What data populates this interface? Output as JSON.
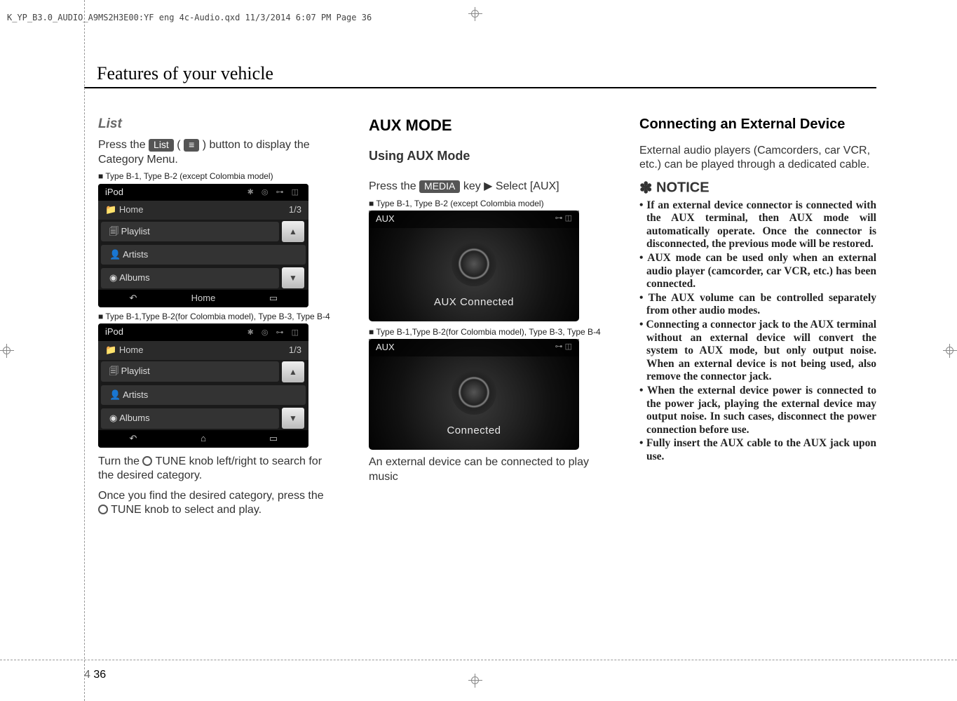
{
  "header_line": "K_YP_B3.0_AUDIO_A9MS2H3E00:YF eng 4c-Audio.qxd  11/3/2014  6:07 PM  Page 36",
  "page_title": "Features of your vehicle",
  "col1": {
    "list_heading": "List",
    "press_the": "Press the ",
    "list_keycap": "List",
    "button_to": " button to display the Category Menu.",
    "cap1": "■ Type B-1, Type B-2 (except Colombia model)",
    "cap2": "■ Type B-1,Type B-2(for Colombia model), Type B-3, Type B-4",
    "ipod": "iPod",
    "home": "Home",
    "count": "1/3",
    "playlist": "Playlist",
    "artists": "Artists",
    "albums": "Albums",
    "home_btn": "Home",
    "turn": "Turn the ",
    "tune1": "TUNE knob left/right to search for the desired category.",
    "once": "Once you find the desired category, press the ",
    "tune2": "TUNE knob to select and play."
  },
  "col2": {
    "h2": "AUX MODE",
    "sub": "Using AUX Mode",
    "press_the": "Press the ",
    "media_key": "MEDIA",
    "key_select": " key ▶ Select [AUX]",
    "cap1": "■ Type B-1, Type B-2 (except Colombia model)",
    "cap2": "■ Type B-1,Type B-2(for Colombia model), Type B-3, Type B-4",
    "aux": "AUX",
    "connected1": "AUX Connected",
    "connected2": "Connected",
    "ext": "An external device can be connected to play music"
  },
  "col3": {
    "h2": "Connecting an External Device",
    "intro": "External audio players (Camcorders, car VCR, etc.) can be played through a dedicated cable.",
    "notice": "NOTICE",
    "bullets": [
      "If an external device connector is connected with the AUX terminal, then AUX mode will automatically operate. Once the connector is disconnected, the previous mode will be restored.",
      "AUX mode can be used only when an external audio player (camcorder, car VCR, etc.) has been connected.",
      "The AUX volume can be controlled separately from other audio modes.",
      "Connecting a connector jack to the AUX terminal without an external device will convert the system to AUX mode, but only output noise. When an external device is not being used, also remove the connector jack.",
      "When the external device power is connected to the power jack, playing the external device may output noise. In such cases, disconnect the power connection before use.",
      "Fully insert the AUX cable to the AUX jack upon use."
    ]
  },
  "page_section": "4",
  "page_number": "36"
}
